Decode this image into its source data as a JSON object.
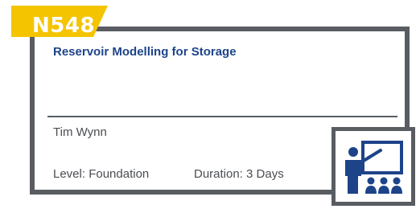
{
  "course": {
    "code": "N548",
    "title": "Reservoir Modelling for Storage",
    "trainer": "Tim Wynn",
    "level": "Level: Foundation",
    "duration": "Duration: 3 Days"
  },
  "icon": {
    "name": "classroom-training-icon",
    "color": "#1d4489"
  },
  "colors": {
    "badge": "#f5c400",
    "frame": "#595d62",
    "title": "#1d4489",
    "text": "#4a4d52"
  }
}
